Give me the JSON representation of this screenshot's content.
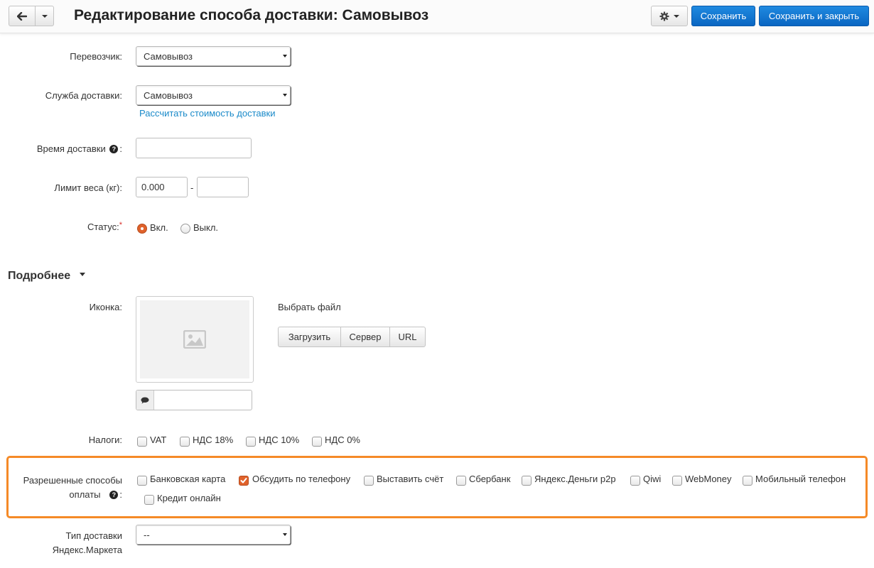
{
  "header": {
    "title": "Редактирование способа доставки: Самовывоз",
    "save_label": "Сохранить",
    "save_close_label": "Сохранить и закрыть"
  },
  "form": {
    "carrier": {
      "label": "Перевозчик:",
      "value": "Самовывоз"
    },
    "service": {
      "label": "Служба доставки:",
      "value": "Самовывоз",
      "link": "Рассчитать стоимость доставки"
    },
    "delivery_time": {
      "label": "Время доставки",
      "value": ""
    },
    "weight_limit": {
      "label": "Лимит веса (кг):",
      "min": "0.000",
      "separator": "-",
      "max": ""
    },
    "status": {
      "label": "Статус:",
      "required_mark": "*",
      "on_label": "Вкл.",
      "off_label": "Выкл.",
      "selected": "on"
    }
  },
  "details": {
    "title": "Подробнее",
    "icon_label": "Иконка:",
    "choose_file": "Выбрать файл",
    "upload_buttons": [
      "Загрузить",
      "Сервер",
      "URL"
    ],
    "caption_value": ""
  },
  "taxes": {
    "label": "Налоги:",
    "options": [
      "VAT",
      "НДС 18%",
      "НДС 10%",
      "НДС 0%"
    ]
  },
  "payments": {
    "label_line1": "Разрешенные способы",
    "label_line2": "оплаты",
    "options": [
      {
        "label": "Банковская карта",
        "checked": false
      },
      {
        "label": "Обсудить по телефону",
        "checked": true
      },
      {
        "label": "Выставить счёт",
        "checked": false
      },
      {
        "label": "Сбербанк",
        "checked": false
      },
      {
        "label": "Яндекс.Деньги p2p",
        "checked": false
      },
      {
        "label": "Qiwi",
        "checked": false
      },
      {
        "label": "WebMoney",
        "checked": false
      },
      {
        "label": "Мобильный телефон",
        "checked": false
      },
      {
        "label": "Кредит онлайн",
        "checked": false
      }
    ]
  },
  "market_type": {
    "label_line1": "Тип доставки",
    "label_line2": "Яндекс.Маркета",
    "value": "--"
  },
  "colors": {
    "primary": "#0a66c2",
    "accent": "#e0622b",
    "highlight": "#f58a27",
    "link": "#1a8ac9"
  }
}
